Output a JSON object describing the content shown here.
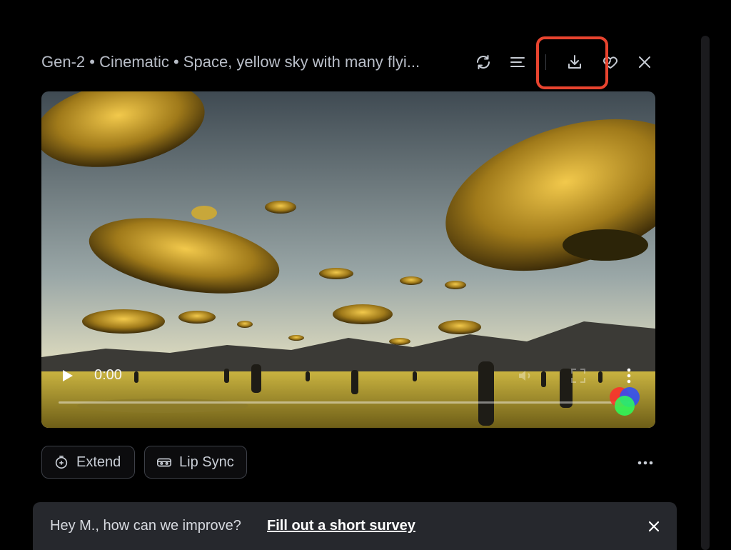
{
  "header": {
    "title": "Gen-2 • Cinematic • Space, yellow sky with many flyi...",
    "icons": [
      "refresh-icon",
      "menu-lines-icon",
      "download-icon",
      "heart-icon",
      "close-icon"
    ]
  },
  "video": {
    "time": "0:00",
    "progress": 0.0
  },
  "actions": {
    "extend_label": "Extend",
    "lip_sync_label": "Lip Sync"
  },
  "survey": {
    "text": "Hey M., how can we improve?",
    "link": "Fill out a short survey"
  },
  "colors": {
    "highlight": "#e8442f",
    "background": "#000000",
    "survey_bg": "#26282d"
  }
}
